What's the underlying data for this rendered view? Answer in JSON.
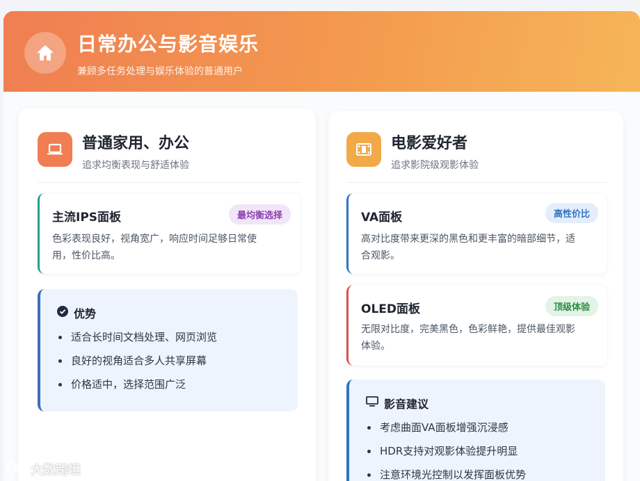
{
  "header": {
    "title": "日常办公与影音娱乐",
    "subtitle": "兼顾多任务处理与娱乐体验的普通用户",
    "icon": "home-icon"
  },
  "colors": {
    "header_start": "#f07e52",
    "header_end": "#f6b558",
    "office_icon_bg": "#f07e52",
    "movie_icon_bg": "#f2a947",
    "teal": "#2a9d8f",
    "blue": "#2f74c0",
    "red": "#d9534f"
  },
  "left": {
    "title": "普通家用、办公",
    "subtitle": "追求均衡表现与舒适体验",
    "icon": "laptop-icon",
    "item": {
      "name": "主流IPS面板",
      "badge": "最均衡选择",
      "desc_line1": "色彩表现良好，视角宽广，响应时间足够日常使",
      "desc_line2": "用，性价比高。"
    },
    "advantages": {
      "title": "优势",
      "icon": "check-circle-icon",
      "items": [
        "适合长时间文档处理、网页浏览",
        "良好的视角适合多人共享屏幕",
        "价格适中，选择范围广泛"
      ]
    }
  },
  "right": {
    "title": "电影爱好者",
    "subtitle": "追求影院级观影体验",
    "icon": "film-icon",
    "items": [
      {
        "name": "VA面板",
        "badge": "高性价比",
        "desc_line1": "高对比度带来更深的黑色和更丰富的暗部细节，适",
        "desc_line2": "合观影。"
      },
      {
        "name": "OLED面板",
        "badge": "顶级体验",
        "desc_line1": "无限对比度，完美黑色，色彩鲜艳，提供最佳观影",
        "desc_line2": "体验。"
      }
    ],
    "suggestions": {
      "title": "影音建议",
      "icon": "monitor-icon",
      "items": [
        "考虑曲面VA面板增强沉浸感",
        "HDR支持对观影体验提升明显",
        "注意环境光控制以发挥面板优势"
      ]
    }
  },
  "watermark": "大数跨境"
}
